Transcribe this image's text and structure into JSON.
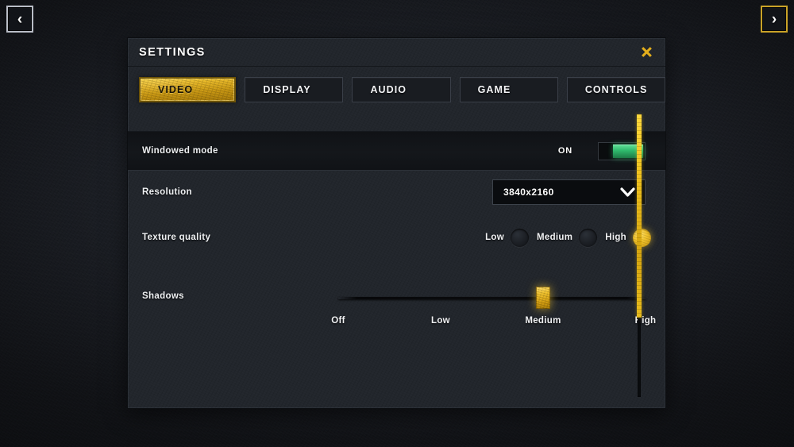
{
  "nav": {
    "prev_label": "‹",
    "prev_icon": "chevron-left-icon",
    "next_label": "›",
    "next_icon": "chevron-right-icon"
  },
  "panel": {
    "title": "SETTINGS",
    "close_icon": "close-icon"
  },
  "tabs": [
    {
      "label": "VIDEO",
      "active": true
    },
    {
      "label": "DISPLAY",
      "active": false
    },
    {
      "label": "AUDIO",
      "active": false
    },
    {
      "label": "GAME",
      "active": false
    },
    {
      "label": "CONTROLS",
      "active": false
    }
  ],
  "settings": {
    "windowed_mode": {
      "label": "Windowed mode",
      "state_label": "ON",
      "value": true
    },
    "resolution": {
      "label": "Resolution",
      "value": "3840x2160",
      "chevron_icon": "chevron-down-icon"
    },
    "texture_quality": {
      "label": "Texture quality",
      "options": [
        {
          "label": "Low",
          "selected": false
        },
        {
          "label": "Medium",
          "selected": false
        },
        {
          "label": "High",
          "selected": true
        }
      ]
    },
    "shadows": {
      "label": "Shadows",
      "ticks": [
        "Off",
        "Low",
        "Medium",
        "High"
      ],
      "value": "Medium",
      "value_index": 2
    }
  },
  "scrollbar": {
    "thumb_position_percent": 0,
    "thumb_size_percent": 72
  },
  "colors": {
    "accent_gold": "#f0c21e",
    "toggle_on_green": "#2fb96c",
    "panel_bg": "#22262c",
    "text_primary": "#ffffff"
  }
}
